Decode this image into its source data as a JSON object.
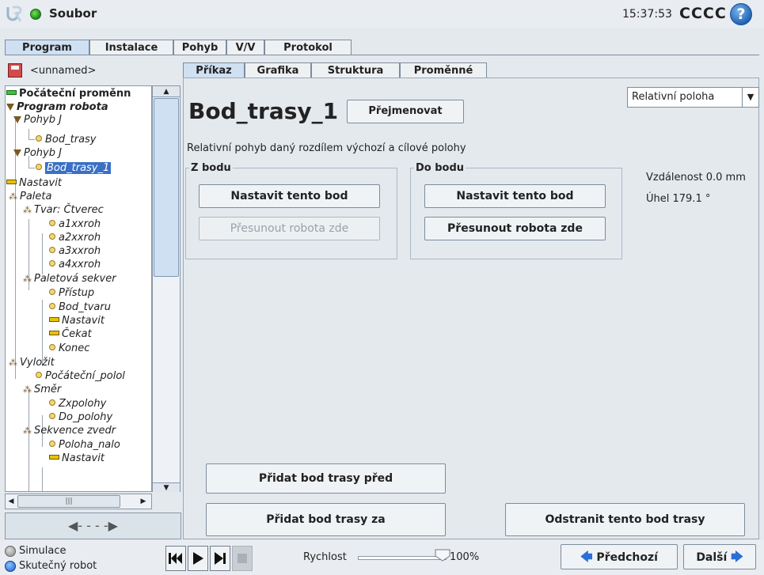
{
  "header": {
    "file_menu": "Soubor",
    "time": "15:37:53",
    "robot_name": "CCCC",
    "help": "?"
  },
  "main_tabs": [
    "Program",
    "Instalace",
    "Pohyb",
    "V/V",
    "Protokol"
  ],
  "program_name": "<unnamed>",
  "tree": [
    {
      "label": "Počáteční proměnn",
      "icon": "bar-green",
      "level": 0,
      "style": "bold"
    },
    {
      "label": "Program robota",
      "icon": "triangle",
      "level": 0,
      "style": "bold-italic"
    },
    {
      "label": "Pohyb J",
      "icon": "triangle",
      "level": 1,
      "style": "italic"
    },
    {
      "label": "Bod_trasy",
      "icon": "dot",
      "level": 2,
      "style": "italic"
    },
    {
      "label": "Pohyb J",
      "icon": "triangle",
      "level": 1,
      "style": "italic"
    },
    {
      "label": "Bod_trasy_1",
      "icon": "dot",
      "level": 2,
      "style": "italic",
      "selected": true
    },
    {
      "label": "Nastavit",
      "icon": "bar",
      "level": 1,
      "style": "italic"
    },
    {
      "label": "Paleta",
      "icon": "pallet",
      "level": 1,
      "style": "italic"
    },
    {
      "label": "Tvar: Čtverec",
      "icon": "pallet",
      "level": 2,
      "style": "italic"
    },
    {
      "label": "a1xxroh",
      "icon": "dot",
      "level": 3,
      "style": "italic"
    },
    {
      "label": "a2xxroh",
      "icon": "dot",
      "level": 3,
      "style": "italic"
    },
    {
      "label": "a3xxroh",
      "icon": "dot",
      "level": 3,
      "style": "italic"
    },
    {
      "label": "a4xxroh",
      "icon": "dot",
      "level": 3,
      "style": "italic"
    },
    {
      "label": "Paletová sekver",
      "icon": "pallet",
      "level": 2,
      "style": "italic"
    },
    {
      "label": "Přístup",
      "icon": "dot",
      "level": 3,
      "style": "italic"
    },
    {
      "label": "Bod_tvaru",
      "icon": "dot",
      "level": 3,
      "style": "italic"
    },
    {
      "label": "Nastavit",
      "icon": "bar",
      "level": 3,
      "style": "italic"
    },
    {
      "label": "Čekat",
      "icon": "bar",
      "level": 3,
      "style": "italic"
    },
    {
      "label": "Konec",
      "icon": "dot",
      "level": 3,
      "style": "italic"
    },
    {
      "label": "Vyložit",
      "icon": "pallet",
      "level": 1,
      "style": "italic"
    },
    {
      "label": "Počáteční_polol",
      "icon": "dot",
      "level": 2,
      "style": "italic"
    },
    {
      "label": "Směr",
      "icon": "pallet",
      "level": 2,
      "style": "italic"
    },
    {
      "label": "Zxpolohy",
      "icon": "dot",
      "level": 3,
      "style": "italic"
    },
    {
      "label": "Do_polohy",
      "icon": "dot",
      "level": 3,
      "style": "italic"
    },
    {
      "label": "Sekvence zvedr",
      "icon": "pallet",
      "level": 2,
      "style": "italic"
    },
    {
      "label": "Poloha_nalo",
      "icon": "dot",
      "level": 3,
      "style": "italic"
    },
    {
      "label": "Nastavit",
      "icon": "bar",
      "level": 3,
      "style": "italic"
    }
  ],
  "sub_tabs": [
    "Příkaz",
    "Grafika",
    "Struktura",
    "Proměnné"
  ],
  "command": {
    "title": "Bod_trasy_1",
    "rename": "Přejmenovat",
    "mode_selected": "Relativní poloha",
    "description": "Relativní pohyb daný rozdílem výchozí a cílové polohy",
    "from_group": "Z bodu",
    "to_group": "Do bodu",
    "set_point": "Nastavit tento bod",
    "move_here": "Přesunout robota zde",
    "distance": "Vzdálenost 0.0 mm",
    "angle": "Úhel 179.1 °",
    "add_before": "Přidat bod trasy před",
    "add_after": "Přidat bod trasy za",
    "remove": "Odstranit tento bod trasy"
  },
  "footer": {
    "simulation": "Simulace",
    "real_robot": "Skutečný robot",
    "speed_label": "Rychlost",
    "speed_value": "100%",
    "speed_fraction": 1.0,
    "prev": "Předchozí",
    "next": "Další"
  }
}
